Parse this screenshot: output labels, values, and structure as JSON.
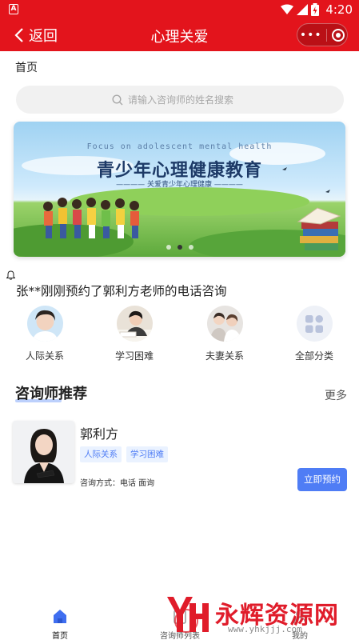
{
  "status_bar": {
    "app_badge": "A",
    "time": "4:20"
  },
  "header": {
    "back_label": "返回",
    "title": "心理关爱"
  },
  "breadcrumb": "首页",
  "search": {
    "placeholder": "请输入咨询师的姓名搜索"
  },
  "banner": {
    "english_line": "Focus on adolescent mental health",
    "title": "青少年心理健康教育",
    "subtitle": "关爱青少年心理健康",
    "slide_count": 3,
    "active_slide": 2
  },
  "notice": "张**刚刚预约了郭利方老师的电话咨询",
  "categories": [
    {
      "label": "人际关系",
      "icon": "avatar-photo"
    },
    {
      "label": "学习困难",
      "icon": "avatar-photo"
    },
    {
      "label": "夫妻关系",
      "icon": "avatar-photo"
    },
    {
      "label": "全部分类",
      "icon": "grid-icon"
    }
  ],
  "section": {
    "title": "咨询师推荐",
    "more": "更多"
  },
  "counselor": {
    "name": "郭利方",
    "tags": [
      "人际关系",
      "学习困难"
    ],
    "method": "咨询方式：电话 面询",
    "book_label": "立即预约"
  },
  "tabbar": {
    "items": [
      {
        "label": "首页",
        "icon": "home-icon",
        "active": true
      },
      {
        "label": "咨询师列表",
        "icon": "list-icon",
        "active": false
      },
      {
        "label": "我的",
        "icon": "user-icon",
        "active": false
      }
    ]
  },
  "watermark": {
    "text": "永辉资源网",
    "url": "www.yhkjjj.com"
  },
  "colors": {
    "brand_red": "#e3141c",
    "accent_blue": "#4f7df5",
    "tag_bg": "#eaf2ff"
  }
}
